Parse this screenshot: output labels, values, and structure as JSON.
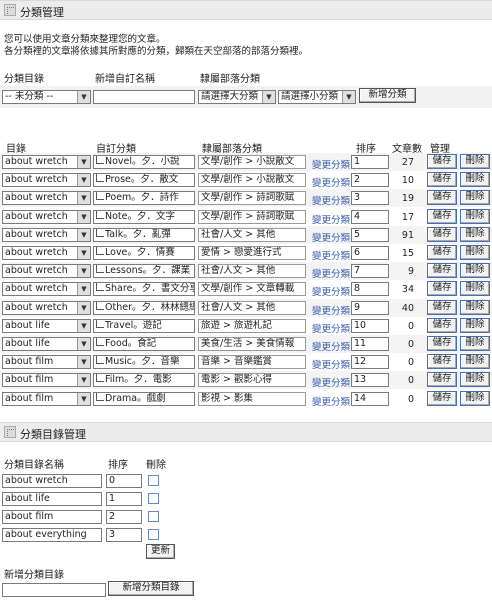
{
  "section1": {
    "title": "分類管理",
    "intro_line1": "您可以使用文章分類來整理您的文章。",
    "intro_line2": "各分類裡的文章將依據其所對應的分類，歸類在天空部落的部落分類裡。"
  },
  "addform": {
    "col_catalog": "分類目錄",
    "col_newname": "新增自訂名稱",
    "col_blogcat": "隸屬部落分類",
    "catalog_selected": "-- 未分類 --",
    "newname_value": "",
    "major_select": "請選擇大分類",
    "minor_select": "請選擇小分類",
    "add_button": "新增分類"
  },
  "table": {
    "headers": {
      "catalog": "目錄",
      "custom": "自訂分類",
      "blogcat": "隸屬部落分類",
      "order": "排序",
      "count": "文章數",
      "manage": "管理"
    },
    "change_link": "變更分類",
    "save_label": "儲存",
    "delete_label": "刪除",
    "rows": [
      {
        "catalog": "about wretch",
        "name": "Novel。夕．小說",
        "cat": "文學/創作 > 小說散文",
        "order": "1",
        "count": "27"
      },
      {
        "catalog": "about wretch",
        "name": "Prose。夕．散文",
        "cat": "文學/創作 > 小說散文",
        "order": "2",
        "count": "10"
      },
      {
        "catalog": "about wretch",
        "name": "Poem。夕．詩作",
        "cat": "文學/創作 > 詩詞歌賦",
        "order": "3",
        "count": "19"
      },
      {
        "catalog": "about wretch",
        "name": "Note。夕．文字",
        "cat": "文學/創作 > 詩詞歌賦",
        "order": "4",
        "count": "17"
      },
      {
        "catalog": "about wretch",
        "name": "Talk。夕．亂彈",
        "cat": "社會/人文 > 其他",
        "order": "5",
        "count": "91"
      },
      {
        "catalog": "about wretch",
        "name": "Love。夕．情賽",
        "cat": "愛情 > 戀愛進行式",
        "order": "6",
        "count": "15"
      },
      {
        "catalog": "about wretch",
        "name": "Lessons。夕．課業",
        "cat": "社會/人文 > 其他",
        "order": "7",
        "count": "9"
      },
      {
        "catalog": "about wretch",
        "name": "Share。夕．書文分享",
        "cat": "文學/創作 > 文章轉載",
        "order": "8",
        "count": "34"
      },
      {
        "catalog": "about wretch",
        "name": "Other。夕．林林總總",
        "cat": "社會/人文 > 其他",
        "order": "9",
        "count": "40"
      },
      {
        "catalog": "about life",
        "name": "Travel。遊記",
        "cat": "旅遊 > 旅遊札記",
        "order": "10",
        "count": "0"
      },
      {
        "catalog": "about life",
        "name": "Food。食記",
        "cat": "美食/生活 > 美食情報",
        "order": "11",
        "count": "0"
      },
      {
        "catalog": "about film",
        "name": "Music。夕．音樂",
        "cat": "音樂 > 音樂鑑賞",
        "order": "12",
        "count": "0"
      },
      {
        "catalog": "about film",
        "name": "Film。夕．電影",
        "cat": "電影 > 觀影心得",
        "order": "13",
        "count": "0"
      },
      {
        "catalog": "about film",
        "name": "Drama。戲劇",
        "cat": "影視 > 影集",
        "order": "14",
        "count": "0"
      }
    ]
  },
  "section2": {
    "title": "分類目錄管理",
    "col_name": "分類目錄名稱",
    "col_order": "排序",
    "col_delete": "刪除",
    "rows": [
      {
        "name": "about wretch",
        "order": "0"
      },
      {
        "name": "about life",
        "order": "1"
      },
      {
        "name": "about film",
        "order": "2"
      },
      {
        "name": "about everything",
        "order": "3"
      }
    ],
    "update_button": "更新",
    "new_label": "新增分類目錄",
    "new_value": "",
    "new_button": "新增分類目錄"
  }
}
